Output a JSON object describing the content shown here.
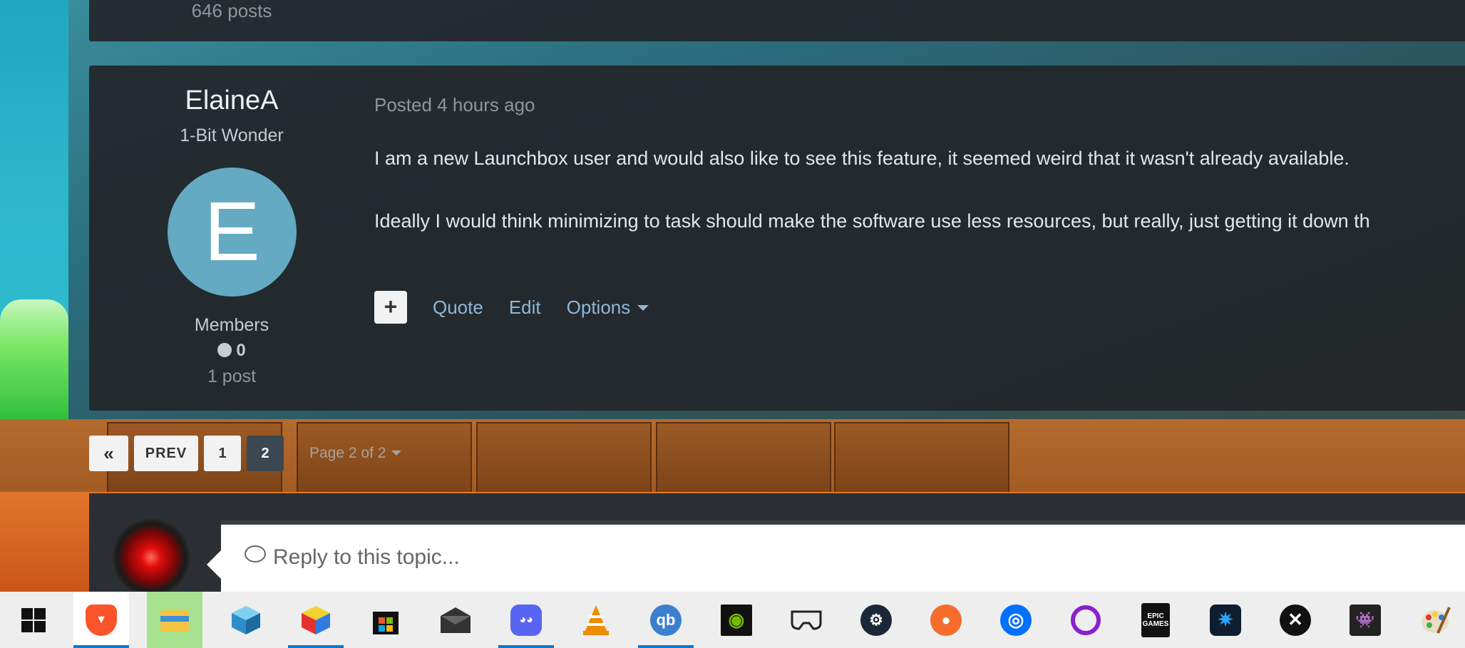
{
  "previous_post": {
    "post_count": "646 posts"
  },
  "post": {
    "author": {
      "name": "ElaineA",
      "rank": "1-Bit Wonder",
      "avatar_letter": "E",
      "group": "Members",
      "reputation": "0",
      "post_count": "1 post"
    },
    "meta": "Posted 4 hours ago",
    "paragraphs": [
      "I am a new Launchbox user and would also like to see this feature, it seemed weird that it wasn't already available.",
      "Ideally I would think minimizing to task should make the software use less resources, but really, just getting it down th"
    ],
    "actions": {
      "react": "+",
      "quote": "Quote",
      "edit": "Edit",
      "options": "Options"
    }
  },
  "pagination": {
    "first": "«",
    "prev": "PREV",
    "pages": [
      "1",
      "2"
    ],
    "current_page": "2",
    "page_label": "Page 2 of 2"
  },
  "reply": {
    "placeholder": "Reply to this topic..."
  },
  "taskbar": {
    "items": [
      {
        "name": "start-icon"
      },
      {
        "name": "brave-icon",
        "active": true
      },
      {
        "name": "file-explorer-icon"
      },
      {
        "name": "3d-cube-icon"
      },
      {
        "name": "rubiks-cube-icon",
        "active": true
      },
      {
        "name": "microsoft-store-icon"
      },
      {
        "name": "mail-icon"
      },
      {
        "name": "discord-icon",
        "active": true
      },
      {
        "name": "vlc-icon"
      },
      {
        "name": "qbittorrent-icon",
        "label": "qb",
        "active": true
      },
      {
        "name": "nvidia-icon"
      },
      {
        "name": "vr-headset-icon"
      },
      {
        "name": "steam-icon"
      },
      {
        "name": "origin-icon"
      },
      {
        "name": "uplay-icon"
      },
      {
        "name": "circle-app-icon"
      },
      {
        "name": "epic-games-icon",
        "label": "EPIC GAMES"
      },
      {
        "name": "battle-net-icon"
      },
      {
        "name": "xbox-icon"
      },
      {
        "name": "retro-game-icon"
      },
      {
        "name": "paint-palette-icon"
      }
    ]
  },
  "colors": {
    "link": "#8fb7db",
    "avatar_bg": "#64aac3",
    "taskbar_indicator": "#0b78d1"
  }
}
